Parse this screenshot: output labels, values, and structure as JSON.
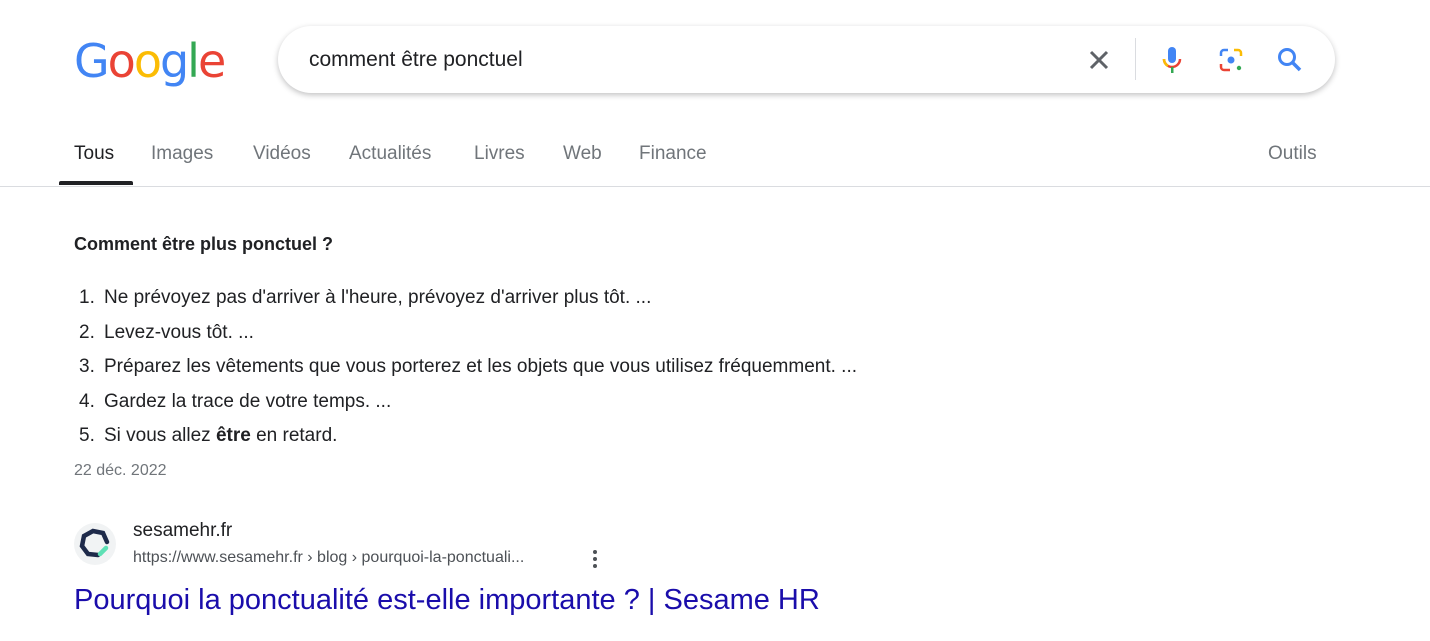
{
  "logo": "Google",
  "search": {
    "query": "comment être ponctuel"
  },
  "tabs": [
    "Tous",
    "Images",
    "Vidéos",
    "Actualités",
    "Livres",
    "Web",
    "Finance"
  ],
  "tools": "Outils",
  "snippet": {
    "heading": "Comment être plus ponctuel ?",
    "items": [
      {
        "num": "1.",
        "text": "Ne prévoyez pas d'arriver à l'heure, prévoyez d'arriver plus tôt. ..."
      },
      {
        "num": "2.",
        "text": "Levez-vous tôt. ..."
      },
      {
        "num": "3.",
        "text": "Préparez les vêtements que vous porterez et les objets que vous utilisez fréquemment. ..."
      },
      {
        "num": "4.",
        "text": "Gardez la trace de votre temps. ..."
      },
      {
        "num": "5.",
        "pre": "Si vous allez ",
        "bold": "être",
        "post": " en retard."
      }
    ],
    "date": "22 déc. 2022"
  },
  "result": {
    "site": "sesamehr.fr",
    "url": "https://www.sesamehr.fr › blog › pourquoi-la-ponctuali...",
    "title": "Pourquoi la ponctualité est-elle importante ? | Sesame HR"
  }
}
